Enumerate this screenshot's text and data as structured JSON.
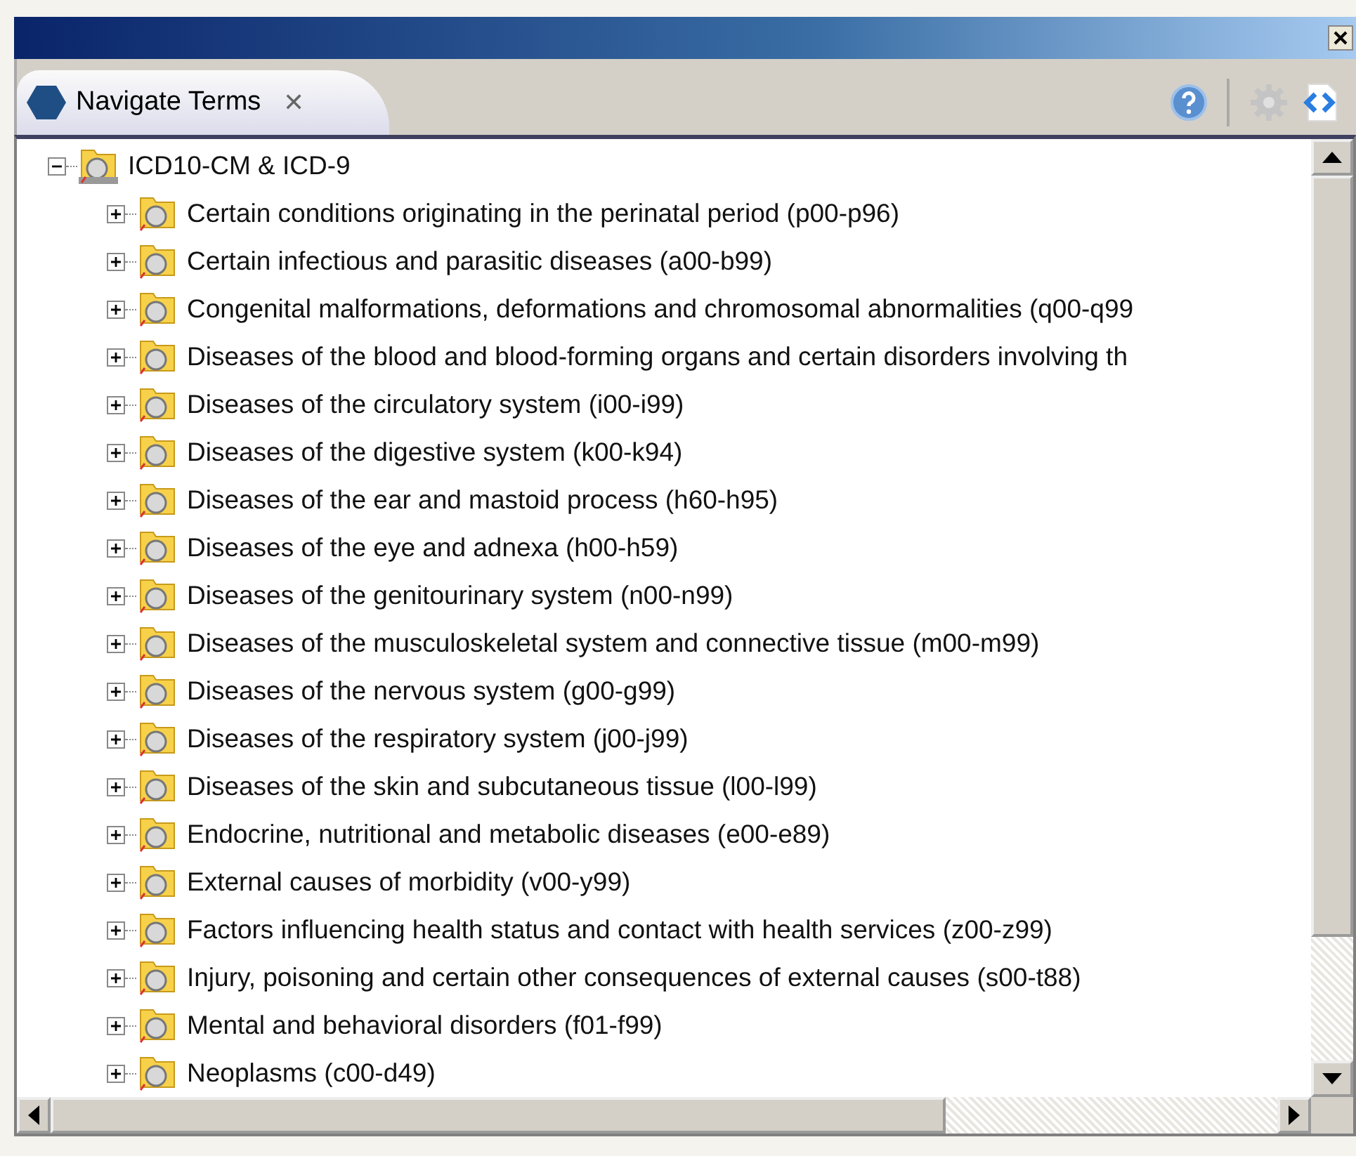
{
  "view_tab": {
    "label": "Navigate Terms",
    "close": "✕",
    "selected": true
  },
  "toolbar": [
    {
      "kind": "help"
    },
    {
      "kind": "settings",
      "disabled": true
    },
    {
      "kind": "code"
    }
  ],
  "tree": [
    {
      "label": "ICD10-CM & ICD-9",
      "kind": "root",
      "expanded": true,
      "children": [
        {
          "label": "Certain conditions originating in the perinatal period (p00-p96)",
          "kind": "category",
          "expanded": false
        },
        {
          "label": "Certain infectious and parasitic diseases (a00-b99)",
          "kind": "category",
          "expanded": false
        },
        {
          "label": "Congenital malformations, deformations and chromosomal abnormalities (q00-q99",
          "kind": "category",
          "expanded": false
        },
        {
          "label": "Diseases of the blood and blood-forming organs and certain disorders involving th",
          "kind": "category",
          "expanded": false
        },
        {
          "label": "Diseases of the circulatory system (i00-i99)",
          "kind": "category",
          "expanded": false
        },
        {
          "label": "Diseases of the digestive system (k00-k94)",
          "kind": "category",
          "expanded": false
        },
        {
          "label": "Diseases of the ear and mastoid process (h60-h95)",
          "kind": "category",
          "expanded": false
        },
        {
          "label": "Diseases of the eye and adnexa (h00-h59)",
          "kind": "category",
          "expanded": false
        },
        {
          "label": "Diseases of the genitourinary system (n00-n99)",
          "kind": "category",
          "expanded": false
        },
        {
          "label": "Diseases of the musculoskeletal system and connective tissue (m00-m99)",
          "kind": "category",
          "expanded": false
        },
        {
          "label": "Diseases of the nervous system (g00-g99)",
          "kind": "category",
          "expanded": false
        },
        {
          "label": "Diseases of the respiratory system (j00-j99)",
          "kind": "category",
          "expanded": false
        },
        {
          "label": "Diseases of the skin and subcutaneous tissue (l00-l99)",
          "kind": "category",
          "expanded": false
        },
        {
          "label": "Endocrine, nutritional and metabolic diseases (e00-e89)",
          "kind": "category",
          "expanded": false
        },
        {
          "label": "External causes of morbidity (v00-y99)",
          "kind": "category",
          "expanded": false
        },
        {
          "label": "Factors influencing health status and contact with health services (z00-z99)",
          "kind": "category",
          "expanded": false
        },
        {
          "label": "Injury, poisoning and certain other consequences of external causes (s00-t88)",
          "kind": "category",
          "expanded": false
        },
        {
          "label": "Mental and behavioral disorders (f01-f99)",
          "kind": "category",
          "expanded": false
        },
        {
          "label": "Neoplasms (c00-d49)",
          "kind": "category",
          "expanded": false
        }
      ]
    }
  ]
}
